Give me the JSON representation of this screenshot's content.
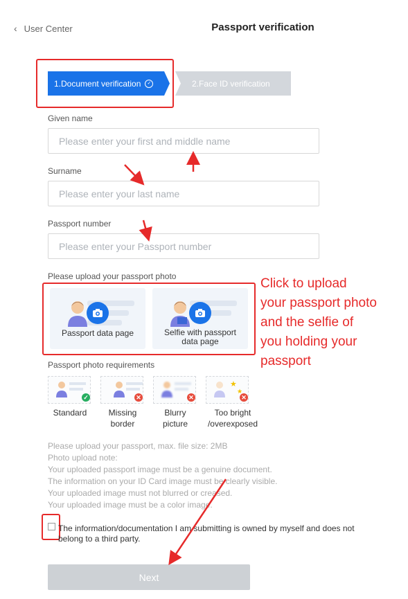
{
  "header": {
    "back_label": "User Center",
    "title": "Passport verification"
  },
  "steps": [
    {
      "label": "1.Document verification",
      "state": "active"
    },
    {
      "label": "2.Face ID verification",
      "state": "inactive"
    }
  ],
  "form": {
    "given_name": {
      "label": "Given name",
      "placeholder": "Please enter your first and middle name",
      "value": ""
    },
    "surname": {
      "label": "Surname",
      "placeholder": "Please enter your last name",
      "value": ""
    },
    "passport_number": {
      "label": "Passport number",
      "placeholder": "Please enter your Passport number",
      "value": ""
    }
  },
  "upload": {
    "label": "Please upload your passport photo",
    "cards": [
      {
        "caption": "Passport data page"
      },
      {
        "caption_line1": "Selfie with passport",
        "caption_line2": "data page"
      }
    ]
  },
  "requirements": {
    "label": "Passport photo requirements",
    "items": [
      {
        "line1": "Standard",
        "line2": "",
        "status": "ok"
      },
      {
        "line1": "Missing",
        "line2": "border",
        "status": "bad"
      },
      {
        "line1": "Blurry",
        "line2": "picture",
        "status": "bad"
      },
      {
        "line1": "Too bright",
        "line2": "/overexposed",
        "status": "bad"
      }
    ]
  },
  "notes": [
    "Please upload your passport, max. file size: 2MB",
    "Photo upload note:",
    "Your uploaded passport image must be a genuine document.",
    "The information on your ID Card image must be clearly visible.",
    "Your uploaded image must not blurred or creased.",
    "Your uploaded image must be a color image."
  ],
  "agreement": {
    "line1": "The information/documentation I am submitting is owned by myself and does not",
    "line2": "belong to a third party.",
    "checked": false
  },
  "next_label": "Next",
  "annotation": {
    "line1": "Click to upload",
    "line2": "your passport photo",
    "line3": "and the selfie of",
    "line4": "you holding your",
    "line5": "passport"
  },
  "colors": {
    "accent": "#1a73e8",
    "annotation_red": "#e62a2a",
    "disabled_button": "#cdd1d5",
    "ok_green": "#27ae60",
    "bad_red": "#e74c3c"
  }
}
